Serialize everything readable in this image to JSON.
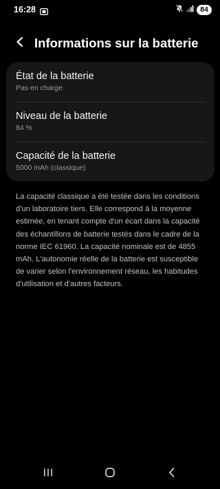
{
  "status_bar": {
    "time": "16:28",
    "battery_level": "84",
    "icons": [
      "screenshot-icon",
      "mute-icon",
      "signal-icon",
      "battery-icon"
    ]
  },
  "header": {
    "back_icon": "chevron-left-icon",
    "title": "Informations sur la batterie"
  },
  "card": {
    "items": [
      {
        "title": "État de la batterie",
        "subtitle": "Pas en charge"
      },
      {
        "title": "Niveau de la batterie",
        "subtitle": "84 %"
      },
      {
        "title": "Capacité de la batterie",
        "subtitle": "5000 mAh (classique)"
      }
    ]
  },
  "info": {
    "paragraph": "La capacité classique a été testée dans les conditions d'un laboratoire tiers. Elle correspond à la moyenne estimée, en tenant compte d'un écart dans la capacité des échantillons de batterie testés dans le cadre de la norme IEC 61960. La capacité nominale est de 4855 mAh. L'autonomie réelle de la batterie est susceptible de varier selon l'environnement réseau, les habitudes d'utilisation et d'autres facteurs."
  },
  "nav_bar": {
    "icons": [
      "recent-apps-icon",
      "home-icon",
      "back-icon"
    ]
  },
  "colors": {
    "background": "#000000",
    "card": "#171717",
    "divider": "#2e2e2e",
    "text_primary": "#f4f4f4",
    "text_secondary": "#9a9a9a",
    "text_body": "#c2c2c2"
  }
}
